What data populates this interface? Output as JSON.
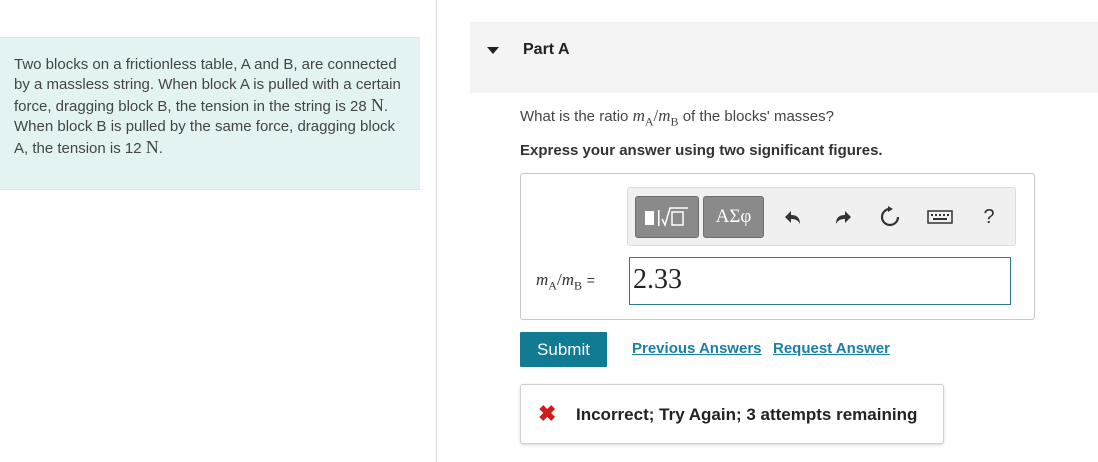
{
  "problem": {
    "text_part1": "Two blocks on a frictionless table, A and B, are connected by a massless string. When block A is pulled with a certain force, dragging block B, the tension in the string is 28",
    "unit1": "N",
    "text_part2": ". When block B is pulled by the same force, dragging block A, the tension is 12",
    "unit2": "N",
    "text_part3": "."
  },
  "part": {
    "title": "Part A"
  },
  "question": {
    "prefix": "What is the ratio",
    "ratio_m1": "m",
    "ratio_sub1": "A",
    "ratio_slash": "/",
    "ratio_m2": "m",
    "ratio_sub2": "B",
    "suffix": "of the blocks' masses?",
    "instruction": "Express your answer using two significant figures."
  },
  "toolbar": {
    "symbols_label": "ΑΣφ",
    "help_label": "?"
  },
  "answer": {
    "label_m1": "m",
    "label_sub1": "A",
    "label_slash": "/",
    "label_m2": "m",
    "label_sub2": "B",
    "label_eq": "=",
    "value": "2.33"
  },
  "actions": {
    "submit_label": "Submit",
    "previous_answers": "Previous Answers",
    "request_answer": "Request Answer"
  },
  "feedback": {
    "text": "Incorrect; Try Again; 3 attempts remaining"
  },
  "colors": {
    "problem_bg": "#e3f3f4",
    "submit_bg": "#107b92",
    "link": "#1a7fa6",
    "error": "#d21b1b",
    "input_border": "#2e7c8a"
  }
}
